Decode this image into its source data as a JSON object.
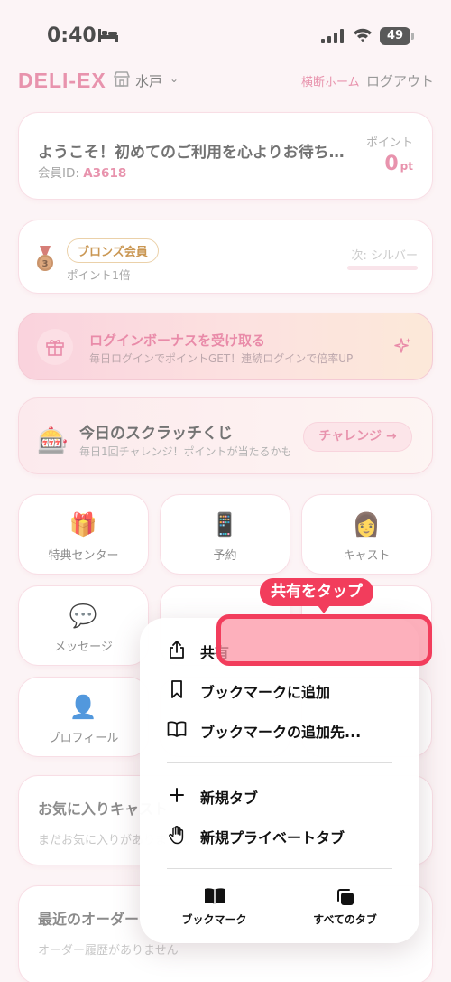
{
  "status_bar": {
    "time": "0:40",
    "battery": "49"
  },
  "header": {
    "logo": "DELI-EX",
    "location": "水戸",
    "home_link": "横断ホーム",
    "logout_link": "ログアウト"
  },
  "welcome": {
    "message": "ようこそ！初めてのご利用を心よりお待ちしております",
    "member_id_label": "会員ID: ",
    "member_id": "A3618",
    "point_label": "ポイント",
    "point_value": "0",
    "point_unit": "pt"
  },
  "rank": {
    "badge": "ブロンズ会員",
    "multiplier": "ポイント1倍",
    "next": "次: シルバー",
    "progress": 0
  },
  "bonus": {
    "title": "ログインボーナスを受け取る",
    "subtitle": "毎日ログインでポイントGET！連続ログインで倍率UP"
  },
  "scratch": {
    "title": "今日のスクラッチくじ",
    "subtitle": "毎日1回チャレンジ！ポイントが当たるかも",
    "button": "チャレンジ →"
  },
  "grid": {
    "benefits": "特典センター",
    "reserve": "予約",
    "cast": "キャスト",
    "messages": "メッセージ",
    "profile": "プロフィール"
  },
  "favorites": {
    "title": "お気に入りキャスト",
    "empty": "まだお気に入りがありません"
  },
  "orders": {
    "title": "最近のオーダー",
    "empty": "オーダー履歴がありません"
  },
  "share_menu": {
    "share": "共有",
    "add_bookmark": "ブックマークに追加",
    "bookmark_to": "ブックマークの追加先...",
    "new_tab": "新規タブ",
    "new_private_tab": "新規プライベートタブ",
    "bookmarks": "ブックマーク",
    "all_tabs": "すべてのタブ"
  },
  "annotation": {
    "callout": "共有をタップ"
  },
  "colors": {
    "accent": "#e06f92",
    "highlight": "#f23d5c",
    "bronze": "#b8741a"
  }
}
